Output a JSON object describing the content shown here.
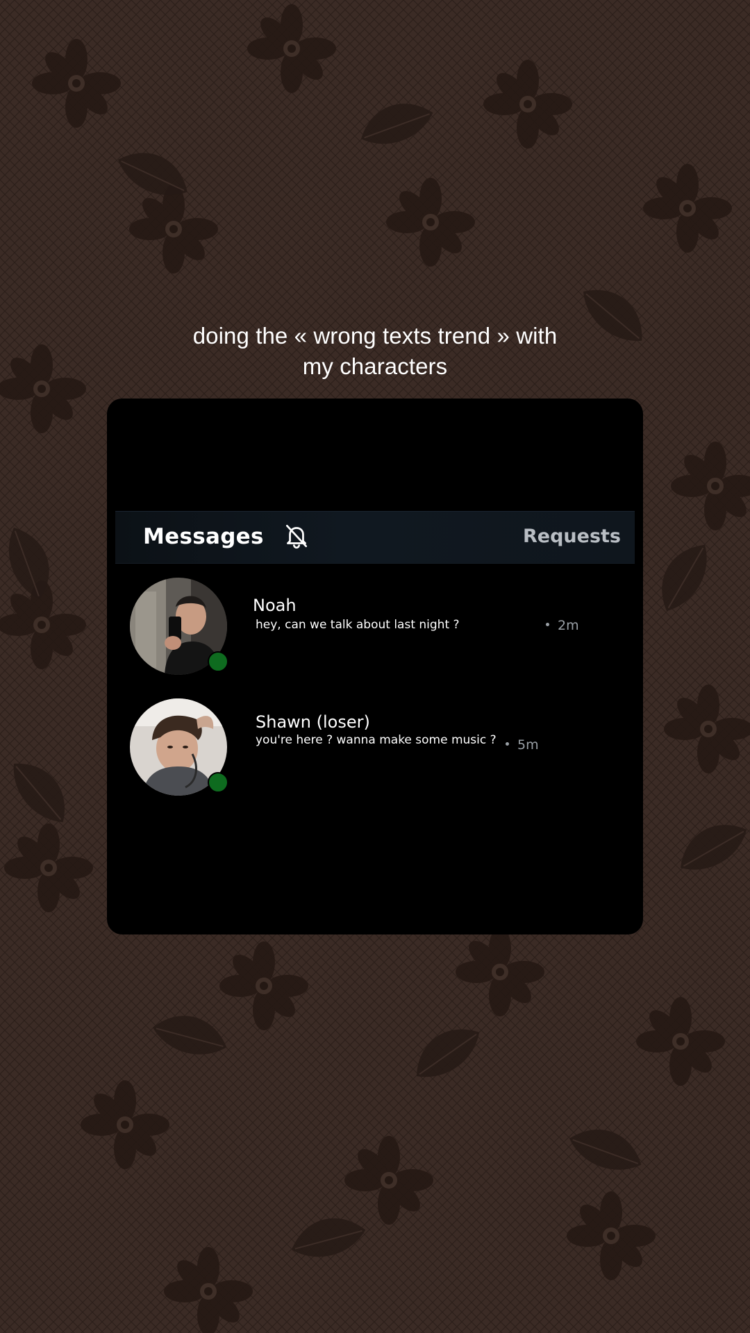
{
  "caption": {
    "line1": "doing the « wrong texts trend » with",
    "line2": "my characters"
  },
  "header": {
    "title": "Messages",
    "bell_icon": "bell-slash-icon",
    "requests_label": "Requests"
  },
  "conversations": [
    {
      "name": "Noah",
      "preview": "hey, can we talk about last night ?",
      "time": "2m",
      "online": true
    },
    {
      "name": "Shawn (loser)",
      "preview": "you're here ? wanna make some music ?",
      "time": "5m",
      "online": true
    }
  ],
  "colors": {
    "background": "#3a2a24",
    "card": "#000000",
    "header": "#101820",
    "online": "#0e6b1f",
    "muted_text": "#9aa0a6"
  }
}
